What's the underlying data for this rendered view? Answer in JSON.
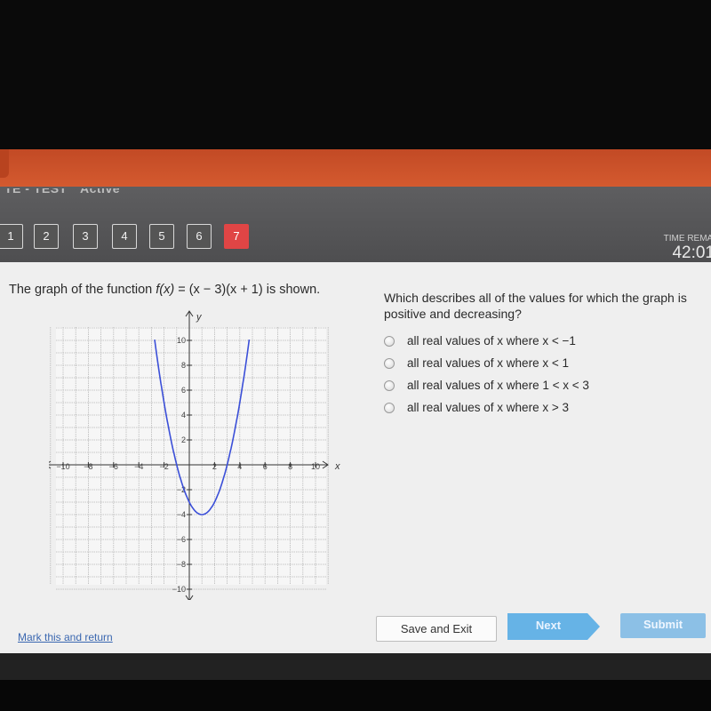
{
  "header": {
    "sub_labels": [
      "TE - TEST",
      "Active"
    ],
    "time_remaining_label": "TIME REMAINING",
    "time_remaining_value": "42:01"
  },
  "question_nav": {
    "items": [
      "1",
      "2",
      "3",
      "4",
      "5",
      "6",
      "7"
    ],
    "active_index": 6
  },
  "question": {
    "prompt_prefix": "The graph of the function ",
    "function_name": "f(x)",
    "prompt_suffix": " = (x − 3)(x + 1) is shown.",
    "ask": "Which describes all of the values for which the graph is positive and decreasing?",
    "options": [
      {
        "label": "all real values of x where x < −1"
      },
      {
        "label": "all real values of x where x < 1"
      },
      {
        "label": "all real values of x where 1 < x < 3"
      },
      {
        "label": "all real values of x where x > 3"
      }
    ]
  },
  "chart_data": {
    "type": "line",
    "title": "",
    "function": "f(x) = (x − 3)(x + 1)",
    "xlabel": "x",
    "ylabel": "y",
    "xlim": [
      -11,
      11
    ],
    "ylim": [
      -11,
      11
    ],
    "grid": true,
    "x_ticks": [
      -10,
      -8,
      -6,
      -4,
      -2,
      2,
      4,
      6,
      8,
      10
    ],
    "x_tick_labels": [
      "−10",
      "−8",
      "−6",
      "−4",
      "−2",
      "2",
      "4",
      "6",
      "8",
      "10"
    ],
    "y_ticks": [
      10,
      8,
      6,
      4,
      2,
      -2,
      -4,
      -6,
      -8,
      -10
    ],
    "y_tick_labels": [
      "10",
      "8",
      "6",
      "4",
      "2",
      "−2",
      "−4",
      "−6",
      "−8",
      "−10"
    ],
    "series": [
      {
        "name": "f(x)",
        "x": [
          -2.5,
          -2,
          -1.5,
          -1,
          -0.5,
          0,
          0.5,
          1,
          1.5,
          2,
          2.5,
          3,
          3.5,
          4,
          4.5
        ],
        "y": [
          9.75,
          5,
          1.75,
          0,
          -1.75,
          -3,
          -3.75,
          -4,
          -3.75,
          -3,
          -1.75,
          0,
          1.75,
          5,
          9.75
        ]
      }
    ]
  },
  "footer": {
    "mark_link": "Mark this and return",
    "save_exit": "Save and Exit",
    "next": "Next",
    "submit": "Submit"
  },
  "colors": {
    "curve": "#3b4fd8",
    "active_question": "#e04545",
    "orange_bar": "#d05530",
    "next_button": "#66b3e6",
    "submit_button": "#8cc0e6"
  }
}
